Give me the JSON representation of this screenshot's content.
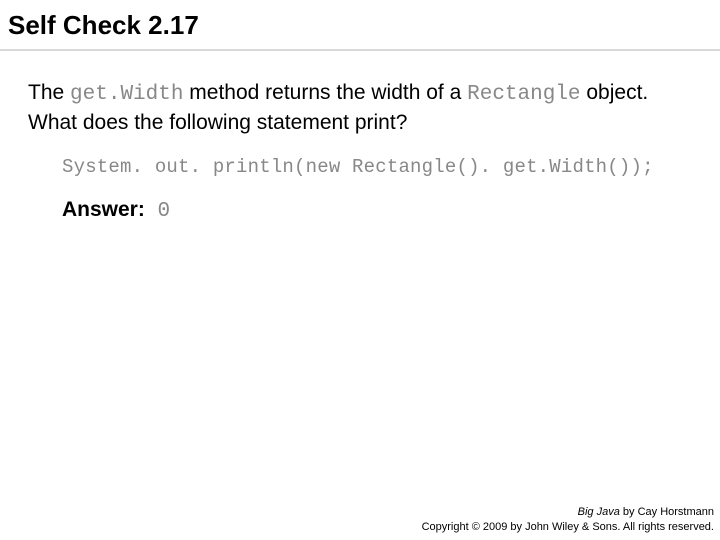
{
  "title": "Self Check 2.17",
  "question": {
    "prefix": "The ",
    "code1": "get.Width",
    "mid1": " method returns the width of a ",
    "code2": "Rectangle",
    "suffix": " object. What does the following statement print?"
  },
  "code_line": "System. out. println(new Rectangle(). get.Width());",
  "answer": {
    "label": "Answer:",
    "value": " 0"
  },
  "footer": {
    "book": "Big Java",
    "byline": " by Cay Horstmann",
    "copyright": "Copyright © 2009 by John Wiley & Sons. All rights reserved."
  }
}
